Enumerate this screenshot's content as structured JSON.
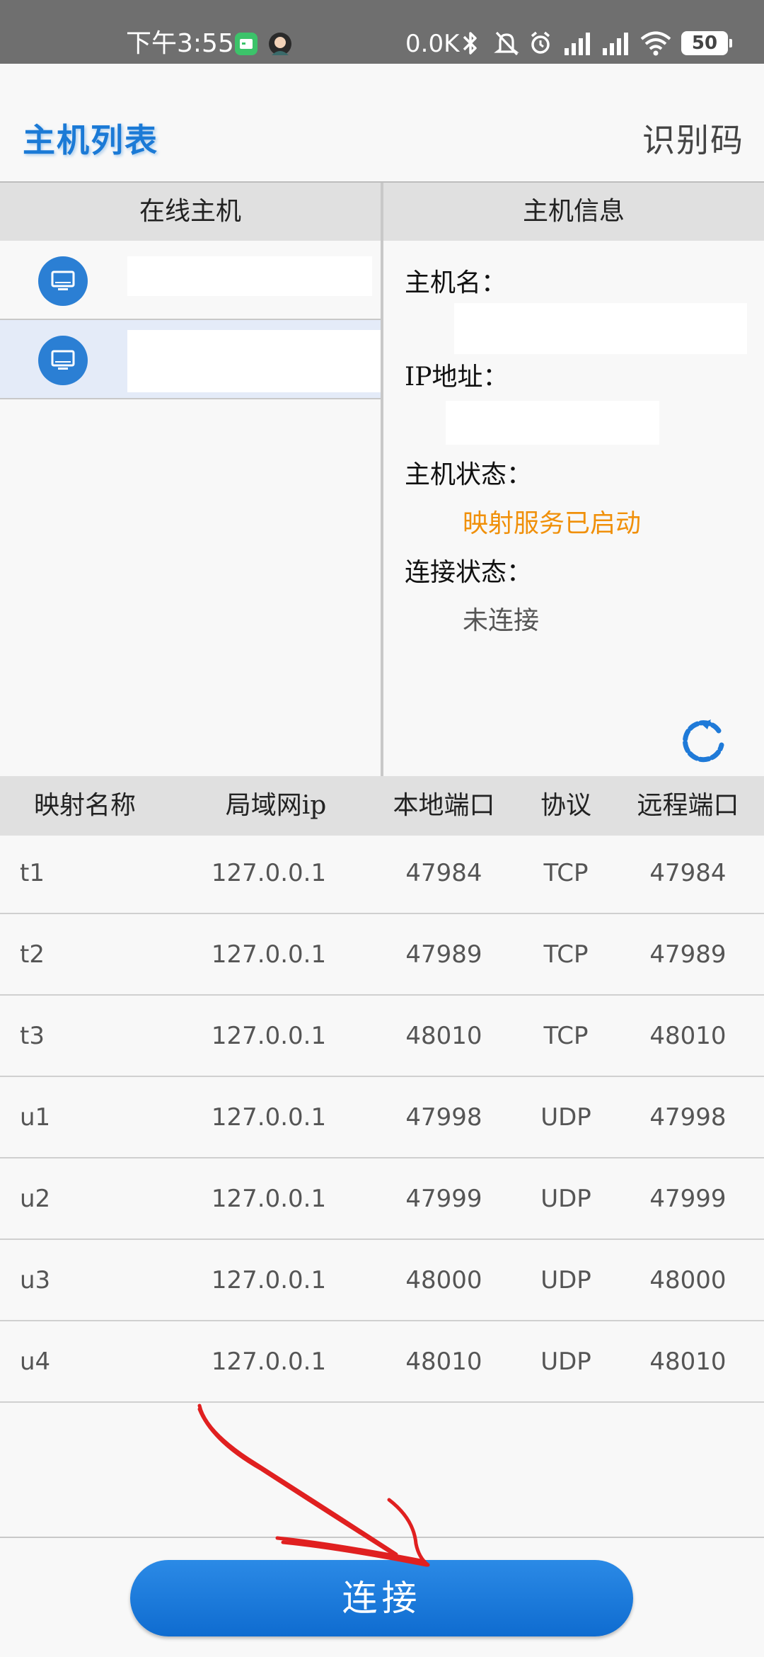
{
  "status_bar": {
    "time": "下午3:55",
    "net_speed": "0.0K",
    "battery": "50",
    "icons": [
      "message-notification-icon",
      "avatar-notification-icon",
      "bluetooth-icon",
      "mute-icon",
      "alarm-icon",
      "signal-icon",
      "signal-icon",
      "wifi-icon",
      "battery-icon"
    ]
  },
  "header": {
    "title": "主机列表",
    "id_code": "识别码"
  },
  "left_panel": {
    "title": "在线主机",
    "hosts": [
      {
        "name": "",
        "selected": false
      },
      {
        "name": "",
        "selected": true
      }
    ]
  },
  "right_panel": {
    "title": "主机信息",
    "hostname_label": "主机名：",
    "hostname_value": "",
    "ip_label": "IP地址：",
    "ip_value": "",
    "host_status_label": "主机状态：",
    "host_status_value": "映射服务已启动",
    "conn_status_label": "连接状态：",
    "conn_status_value": "未连接"
  },
  "table": {
    "headers": [
      "映射名称",
      "局域网ip",
      "本地端口",
      "协议",
      "远程端口"
    ],
    "rows": [
      [
        "t1",
        "127.0.0.1",
        "47984",
        "TCP",
        "47984"
      ],
      [
        "t2",
        "127.0.0.1",
        "47989",
        "TCP",
        "47989"
      ],
      [
        "t3",
        "127.0.0.1",
        "48010",
        "TCP",
        "48010"
      ],
      [
        "u1",
        "127.0.0.1",
        "47998",
        "UDP",
        "47998"
      ],
      [
        "u2",
        "127.0.0.1",
        "47999",
        "UDP",
        "47999"
      ],
      [
        "u3",
        "127.0.0.1",
        "48000",
        "UDP",
        "48000"
      ],
      [
        "u4",
        "127.0.0.1",
        "48010",
        "UDP",
        "48010"
      ]
    ]
  },
  "connect_button": "连接",
  "colors": {
    "accent": "#1b7ad6",
    "status_active": "#f0900a",
    "status_inactive": "#555555",
    "annotation": "#e02020"
  }
}
